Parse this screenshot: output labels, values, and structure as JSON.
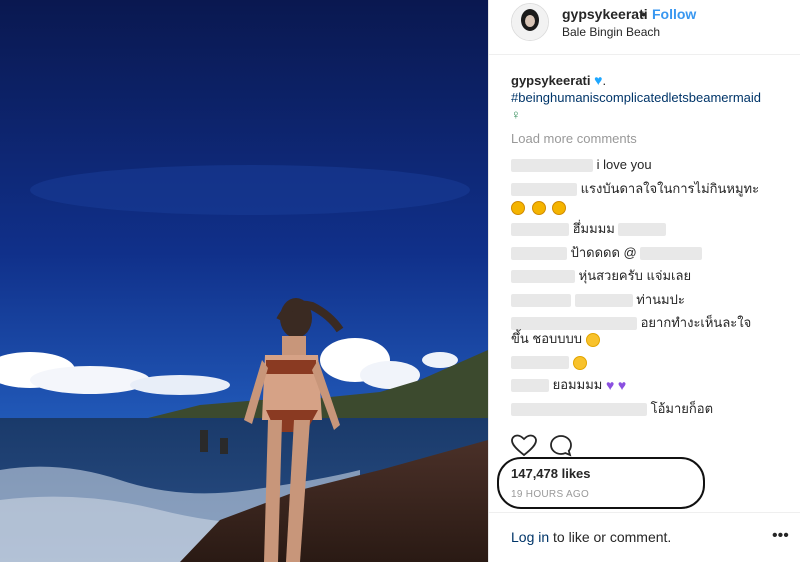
{
  "header": {
    "username": "gypsykeerati",
    "dot": "•",
    "follow_label": "Follow",
    "location": "Bale Bingin Beach"
  },
  "caption": {
    "username": "gypsykeerati",
    "suffix": ".",
    "hashtag": "#beinghumaniscomplicatedletsbeamermaid",
    "heart_icon": "blue-heart-icon"
  },
  "load_more": "Load more comments",
  "comments": [
    {
      "text": "i love you"
    },
    {
      "text": "แรงบันดาลใจในการไม่กินหมูทะ"
    },
    {
      "text": "ฮึ่มมมม"
    },
    {
      "text": "ป้าดดดด @"
    },
    {
      "text": "หุ่นสวยครับ แจ่มเลย"
    },
    {
      "text": "ท่านมปะ"
    },
    {
      "text": "อยากทำงะเห็นละใจ"
    },
    {
      "text": "ขึ้น ชอบบบบ"
    },
    {
      "text": "ยอมมมม"
    },
    {
      "text": "โอ้มายก็อต"
    }
  ],
  "actions": {
    "like_icon": "heart-icon",
    "comment_icon": "comment-bubble-icon"
  },
  "likes": "147,478 likes",
  "timestamp": "19 HOURS AGO",
  "footer": {
    "login_link": "Log in",
    "login_suffix": " to like or comment.",
    "more_icon": "more-dots-icon"
  },
  "colors": {
    "accent": "#3897f0",
    "text": "#262626",
    "muted": "#999999",
    "sky_top": "#0d1d5a",
    "sky_bottom": "#2a64c4"
  }
}
